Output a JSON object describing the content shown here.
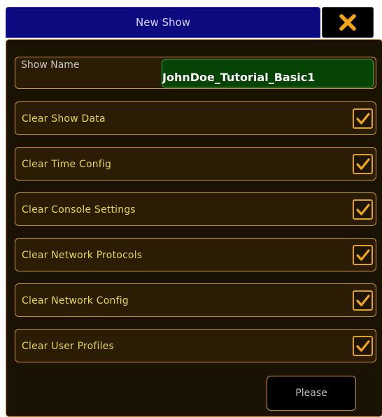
{
  "dialog": {
    "title": "New Show",
    "close_icon": "close-x-icon"
  },
  "show_name": {
    "label": "Show Name",
    "value": "JohnDoe_Tutorial_Basic1"
  },
  "options": [
    {
      "label": "Clear Show Data",
      "checked": true
    },
    {
      "label": "Clear Time Config",
      "checked": true
    },
    {
      "label": "Clear Console Settings",
      "checked": true
    },
    {
      "label": "Clear Network Protocols",
      "checked": true
    },
    {
      "label": "Clear Network Config",
      "checked": true
    },
    {
      "label": "Clear User Profiles",
      "checked": true
    }
  ],
  "footer": {
    "confirm_label": "Please"
  },
  "colors": {
    "title_bg": "#0b0a7e",
    "accent": "#e0a020",
    "label_text": "#e8d64a",
    "input_bg": "#054405"
  }
}
